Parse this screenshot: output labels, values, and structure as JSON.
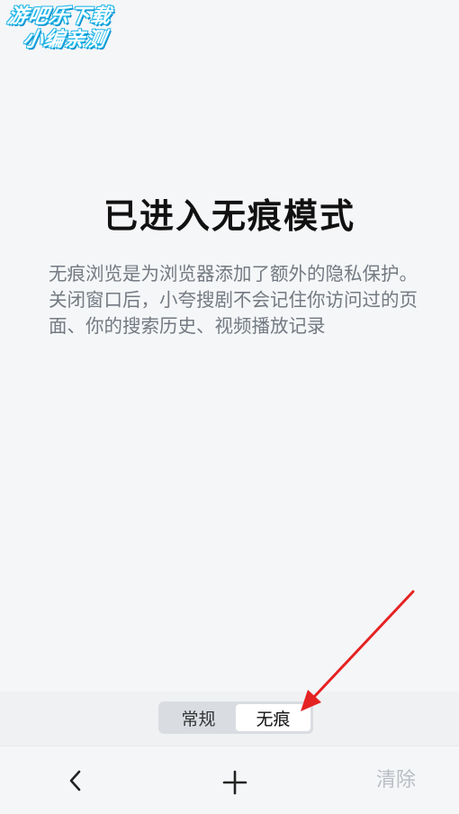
{
  "watermark": {
    "line1": "游吧乐下载",
    "line2": "小编亲测"
  },
  "content": {
    "title": "已进入无痕模式",
    "description": "无痕浏览是为浏览器添加了额外的隐私保护。关闭窗口后，小夸搜剧不会记住你访问过的页面、你的搜索历史、视频播放记录"
  },
  "mode_toggle": {
    "options": [
      "常规",
      "无痕"
    ],
    "selected": "无痕"
  },
  "toolbar": {
    "back_icon": "chevron-left-icon",
    "add_icon": "plus-icon",
    "clear_label": "清除"
  },
  "colors": {
    "background": "#f5f6f8",
    "annotation_arrow": "#e52222",
    "disabled_text": "#b9bec4"
  }
}
